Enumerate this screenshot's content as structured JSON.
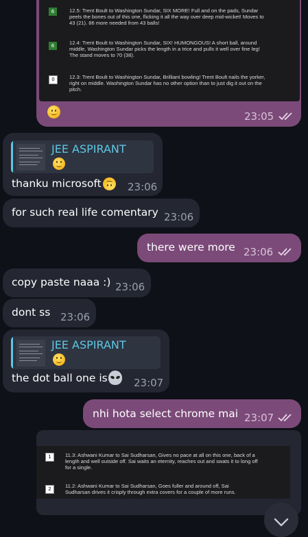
{
  "top_screenshot": {
    "rows": [
      {
        "num": "6",
        "lines": [
          "12.5: Trent Boult to Washington Sundar, SIX MORE! Full and on the pads, Sundar",
          "peels the bones out of this one, flicking it all the way over deep mid-wicket! Moves to",
          "43 (21). 86 more needed from 43 balls!"
        ]
      },
      {
        "num": "6",
        "lines": [
          "12.4: Trent Boult to Washington Sundar, SIX! HUMONGOUS! A short ball, around",
          "middle, Washington Sundar picks the length in a trice and pulls it well over fine leg!",
          "The stand moves to 70 (38)."
        ]
      },
      {
        "num": "0",
        "lines": [
          "12.3: Trent Boult to Washington Sundar, Brilliant bowling! Trent Boult nails the yorker,",
          "right on middle. Washington Sundar has no other option than to just dig it out on the",
          "pitch."
        ]
      }
    ],
    "time": "23:05"
  },
  "messages": {
    "m1": {
      "reply_name": "JEE ASPIRANT",
      "text": "thanku microsoft",
      "time": "23:06"
    },
    "m2": {
      "text": "for such real life comentary",
      "time": "23:06"
    },
    "m3": {
      "text": "there were more",
      "time": "23:06"
    },
    "m4": {
      "text": "copy paste naaa :)",
      "time": "23:06"
    },
    "m5": {
      "text": "dont ss",
      "time": "23:06"
    },
    "m6": {
      "reply_name": "JEE ASPIRANT",
      "text": "the dot ball one is",
      "time": "23:07"
    },
    "m7": {
      "text": "nhi hota select chrome mai",
      "time": "23:07"
    }
  },
  "bottom_screenshot": {
    "rows": [
      {
        "num": "1",
        "lines": [
          "11.3: Ashwani Kumar to Sai Sudharsan, Gives no pace at all on this one, back of a",
          "length and well outside off. Sai waits an eternity, reaches out and swats it to long off",
          "for a single."
        ]
      },
      {
        "num": "2",
        "lines": [
          "11.2: Ashwani Kumar to Sai Sudharsan, Goes fuller and around off, Sai",
          "Sudharsan drives it crisply through extra covers for a couple of more runs."
        ]
      }
    ]
  },
  "colors": {
    "incoming_bubble": "#242632",
    "outgoing_bubble": "#7b4a79",
    "reply_accent": "#5ec8e4",
    "six_badge": "#2e7d32"
  },
  "icons": [
    "double-check-icon",
    "slightly-smiling-face-emoji",
    "upside-down-face-emoji",
    "alien-emoji",
    "chevron-down-icon"
  ]
}
